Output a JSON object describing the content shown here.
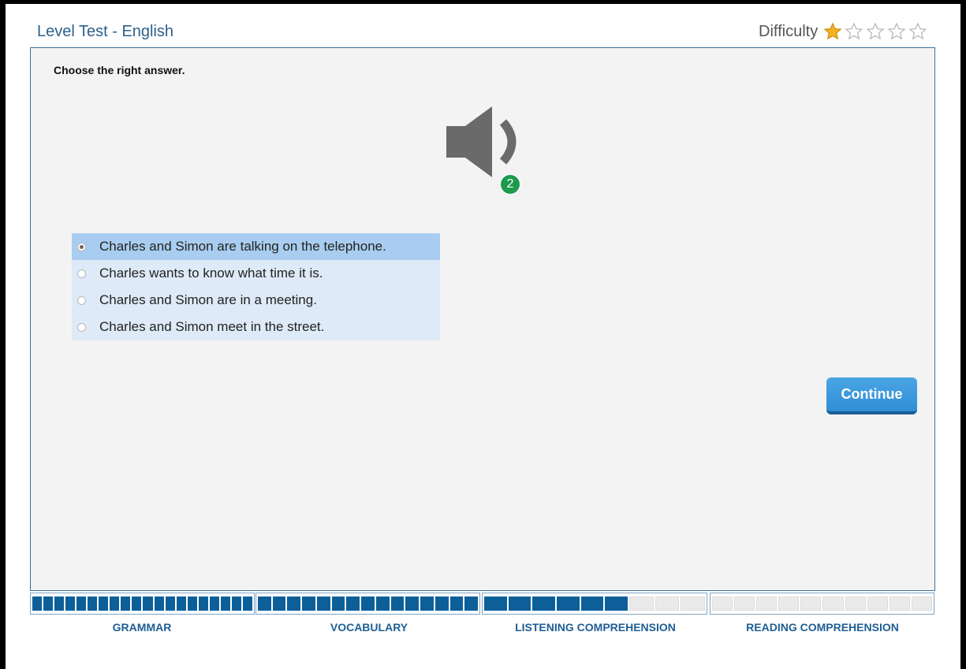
{
  "header": {
    "title": "Level Test - English",
    "difficulty_label": "Difficulty",
    "difficulty_rating": 1,
    "difficulty_max": 5
  },
  "question": {
    "instruction": "Choose the right answer.",
    "audio_icon": "speaker-icon",
    "plays_remaining": "2",
    "options": [
      {
        "label": "Charles and Simon are talking on the telephone.",
        "selected": true
      },
      {
        "label": "Charles wants to know what time it is.",
        "selected": false
      },
      {
        "label": "Charles and Simon are in a meeting.",
        "selected": false
      },
      {
        "label": "Charles and Simon meet in the street.",
        "selected": false
      }
    ]
  },
  "actions": {
    "continue_label": "Continue"
  },
  "progress": {
    "sections": [
      {
        "label": "GRAMMAR",
        "completed": 20,
        "total": 20
      },
      {
        "label": "VOCABULARY",
        "completed": 15,
        "total": 15
      },
      {
        "label": "LISTENING COMPREHENSION",
        "completed": 6,
        "total": 9
      },
      {
        "label": "READING COMPREHENSION",
        "completed": 0,
        "total": 10
      }
    ]
  },
  "colors": {
    "accent": "#2f8ed6",
    "progress_filled": "#0d5f9a",
    "badge": "#1d9a4d",
    "selected_option": "#a9cdf0"
  }
}
